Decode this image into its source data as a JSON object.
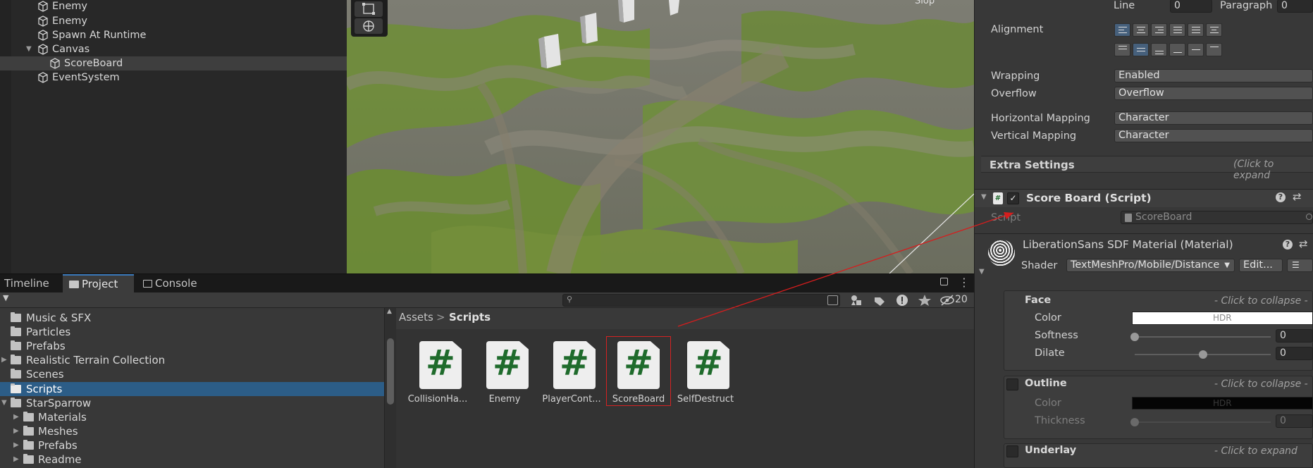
{
  "hierarchy": {
    "items": [
      {
        "label": "Enemy"
      },
      {
        "label": "Enemy"
      },
      {
        "label": "Spawn At Runtime"
      },
      {
        "label": "Canvas"
      },
      {
        "label": "ScoreBoard"
      },
      {
        "label": "EventSystem"
      }
    ]
  },
  "scene": {
    "overlay_text": "Slop"
  },
  "project": {
    "tabs": [
      "Timeline",
      "Project",
      "Console"
    ],
    "search_placeholder": "",
    "hidden_count": "20",
    "folders": [
      {
        "label": "Music & SFX"
      },
      {
        "label": "Particles"
      },
      {
        "label": "Prefabs"
      },
      {
        "label": "Realistic Terrain Collection"
      },
      {
        "label": "Scenes"
      },
      {
        "label": "Scripts"
      },
      {
        "label": "StarSparrow"
      },
      {
        "label": "Materials"
      },
      {
        "label": "Meshes"
      },
      {
        "label": "Prefabs"
      },
      {
        "label": "Readme"
      }
    ],
    "breadcrumb": {
      "root": "Assets",
      "separator": ">",
      "current": "Scripts"
    },
    "assets": [
      {
        "label": "CollisionHa...",
        "glyph": "#"
      },
      {
        "label": "Enemy",
        "glyph": "#"
      },
      {
        "label": "PlayerCont...",
        "glyph": "#"
      },
      {
        "label": "ScoreBoard",
        "glyph": "#"
      },
      {
        "label": "SelfDestruct",
        "glyph": "#"
      }
    ]
  },
  "inspector": {
    "spacing": {
      "line_label": "Line",
      "line_value": "0",
      "paragraph_label": "Paragraph",
      "paragraph_value": "0"
    },
    "alignment_label": "Alignment",
    "wrapping": {
      "label": "Wrapping",
      "value": "Enabled"
    },
    "overflow": {
      "label": "Overflow",
      "value": "Overflow"
    },
    "horizontal_mapping": {
      "label": "Horizontal Mapping",
      "value": "Character"
    },
    "vertical_mapping": {
      "label": "Vertical Mapping",
      "value": "Character"
    },
    "extra_settings": {
      "label": "Extra Settings",
      "hint": "(Click to expand"
    },
    "score_board": {
      "title": "Score Board (Script)",
      "script_label": "Script",
      "script_value": "ScoreBoard"
    },
    "material": {
      "title": "LiberationSans SDF Material (Material)",
      "shader_label": "Shader",
      "shader_value": "TextMeshPro/Mobile/Distance",
      "edit_label": "Edit..."
    },
    "face": {
      "title": "Face",
      "hint": "- Click to collapse -",
      "color_label": "Color",
      "color_value": "HDR",
      "softness_label": "Softness",
      "softness_value": "0",
      "softness_level": 0.0,
      "dilate_label": "Dilate",
      "dilate_value": "0",
      "dilate_level": 0.5
    },
    "outline": {
      "title": "Outline",
      "hint": "- Click to collapse -",
      "color_label": "Color",
      "color_value": "HDR",
      "thickness_label": "Thickness",
      "thickness_value": "0",
      "thickness_level": 0.0
    },
    "underlay": {
      "title": "Underlay",
      "hint": "- Click to expand"
    }
  },
  "colors": {
    "selection_blue": "#2c5d87",
    "accent_red": "#d62222",
    "script_green": "#1f6b2c",
    "terrain_green": "#6f8e36"
  }
}
